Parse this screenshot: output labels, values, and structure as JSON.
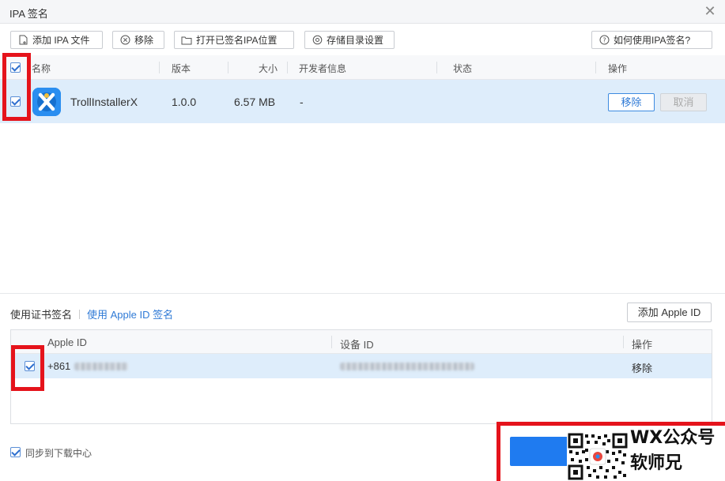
{
  "window": {
    "title": "IPA 签名",
    "close_icon": "close-icon"
  },
  "toolbar": {
    "add_ipa": "添加 IPA 文件",
    "remove": "移除",
    "open_location": "打开已签名IPA位置",
    "storage_settings": "存储目录设置",
    "help": "如何使用IPA签名?"
  },
  "ipa_table": {
    "headers": {
      "name": "名称",
      "version": "版本",
      "size": "大小",
      "developer": "开发者信息",
      "status": "状态",
      "actions": "操作"
    },
    "rows": [
      {
        "checked": true,
        "name": "TrollInstallerX",
        "version": "1.0.0",
        "size": "6.57 MB",
        "developer": "-",
        "status": "",
        "remove_label": "移除",
        "cancel_label": "取消"
      }
    ]
  },
  "signing": {
    "tab_cert": "使用证书签名",
    "tab_apple_id": "使用 Apple ID 签名",
    "active_tab": "使用 Apple ID 签名",
    "add_apple_id": "添加 Apple ID",
    "headers": {
      "apple_id": "Apple ID",
      "device_id": "设备 ID",
      "actions": "操作"
    },
    "rows": [
      {
        "checked": true,
        "apple_id_visible": "+861",
        "remove_label": "移除"
      }
    ]
  },
  "footer": {
    "sync_label": "同步到下载中心",
    "sync_checked": true
  },
  "watermark": {
    "line1": "WX公众号",
    "line2": "软师兄"
  },
  "colors": {
    "accent": "#2f7ad6",
    "row_selected": "#deedfb",
    "annotation_red": "#e5131b",
    "primary_button": "#1f7bf0"
  }
}
